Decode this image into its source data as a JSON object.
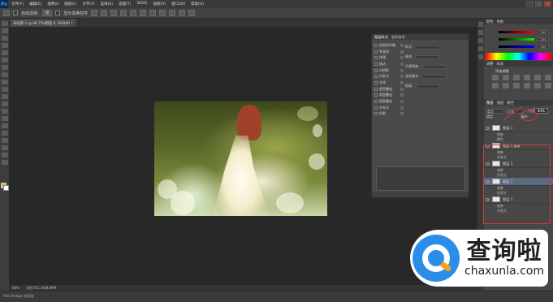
{
  "app": {
    "logo": "Ps"
  },
  "menubar": {
    "items": [
      "文件(F)",
      "编辑(E)",
      "图像(I)",
      "图层(L)",
      "文字(Y)",
      "选择(S)",
      "滤镜(T)",
      "3D(D)",
      "视图(V)",
      "窗口(W)",
      "帮助(H)"
    ]
  },
  "window_controls": {
    "minimize": "–",
    "maximize": "□",
    "close": "×"
  },
  "options_bar": {
    "auto_select_label": "自动选择:",
    "auto_select_value": "组",
    "transform_label": "显示变换控件"
  },
  "tabs": [
    {
      "label": "未标题-1 @ 66.7%(图层 0, RGB/8) *"
    }
  ],
  "status": {
    "zoom": "66%",
    "doc": "文档:911.1K/8.89M"
  },
  "timeline": {
    "label": "Mini Bridge   时间轴"
  },
  "style_panel": {
    "tab_active": "图层样式",
    "tab_other": "混合选项",
    "options": [
      "斜面和浮雕",
      "等高线",
      "纹理",
      "描边",
      "内阴影",
      "内发光",
      "光泽",
      "颜色叠加",
      "渐变叠加",
      "图案叠加",
      "外发光",
      "投影"
    ],
    "prop_labels": [
      "样式:",
      "填充",
      "不透明度:",
      "混合模式:",
      "距离:"
    ]
  },
  "color_panel": {
    "tab_active": "颜色",
    "tab_other": "色板",
    "r": "255",
    "g": "255",
    "b": "255",
    "accent": "#e3b94a"
  },
  "adjust_panel": {
    "tab_active": "调整",
    "tab_other": "样式",
    "label": "添加调整"
  },
  "layers_panel": {
    "tab_active": "图层",
    "tab_other1": "通道",
    "tab_other2": "路径",
    "filter_label": "类型",
    "blend_mode": "正常",
    "opacity_label": "不透明度:",
    "opacity": "83%",
    "lock_label": "锁定:",
    "fill_label": "填充:",
    "layers": [
      {
        "name": "图层 1",
        "fx": [
          "效果",
          "颜色"
        ]
      },
      {
        "name": "图层 1 副本",
        "fx": [
          "效果",
          "外发光"
        ]
      },
      {
        "name": "图层 1",
        "fx": [
          "效果",
          "外发光"
        ]
      },
      {
        "name": "图层 1",
        "fx": [
          "效果",
          "外发光"
        ],
        "selected": true
      },
      {
        "name": "图层 1",
        "fx": [
          "效果",
          "外发光"
        ]
      }
    ]
  },
  "watermark": {
    "cn": "查询啦",
    "en": "chaxunla.com"
  }
}
